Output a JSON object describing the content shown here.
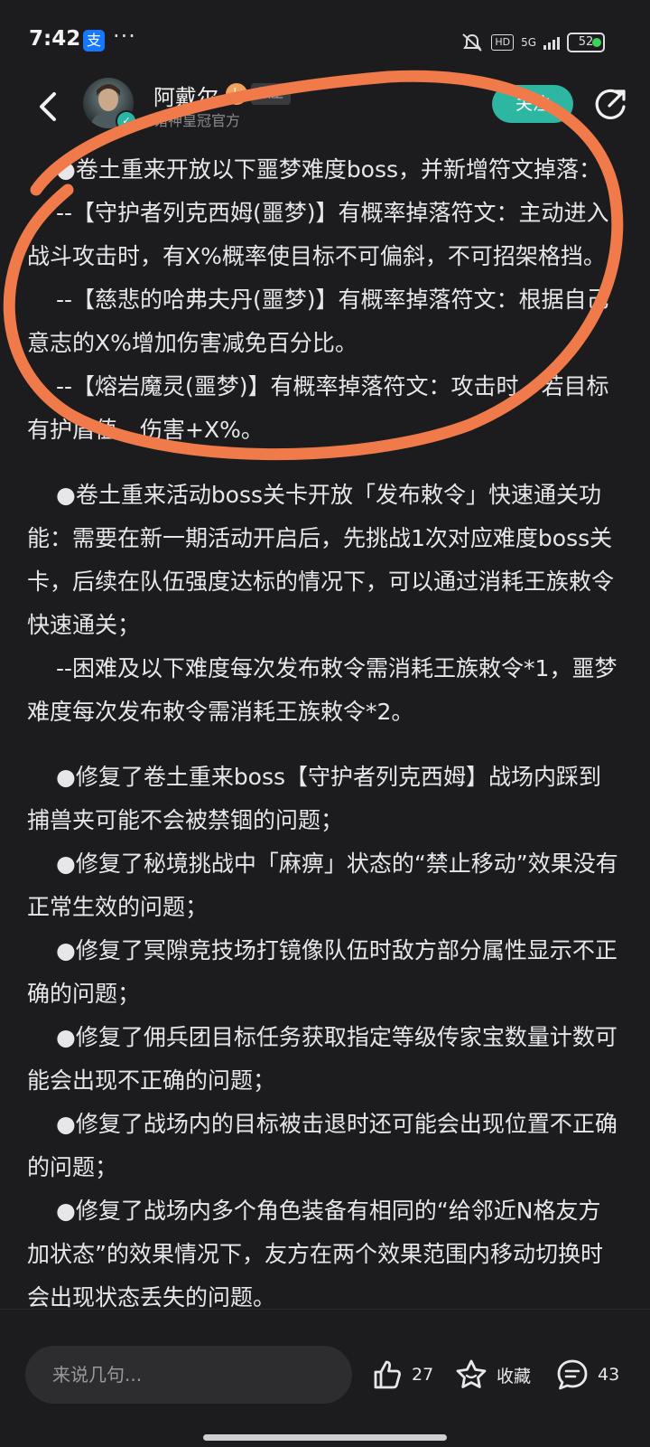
{
  "status_bar": {
    "time": "7:42",
    "app_badge": "支",
    "dots": "···",
    "hd": "HD",
    "network": "5G",
    "battery": "52"
  },
  "header": {
    "author_name": "阿戴尔",
    "level_badge": "L",
    "role_badge": "版主",
    "author_subtitle": "诸神皇冠官方",
    "follow_label": "关注"
  },
  "article": {
    "paragraphs": [
      "●卷土重来开放以下噩梦难度boss，并新增符文掉落：",
      "--【守护者列克西姆(噩梦)】有概率掉落符文：主动进入战斗攻击时，有X%概率使目标不可偏斜，不可招架格挡。",
      "--【慈悲的哈弗夫丹(噩梦)】有概率掉落符文：根据自己意志的X%增加伤害减免百分比。",
      "--【熔岩魔灵(噩梦)】有概率掉落符文：攻击时，若目标有护盾值，伤害+X%。",
      "●卷土重来活动boss关卡开放「发布敕令」快速通关功能：需要在新一期活动开启后，先挑战1次对应难度boss关卡，后续在队伍强度达标的情况下，可以通过消耗王族敕令快速通关；",
      "--困难及以下难度每次发布敕令需消耗王族敕令*1，噩梦难度每次发布敕令需消耗王族敕令*2。",
      "●修复了卷土重来boss【守护者列克西姆】战场内踩到捕兽夹可能不会被禁锢的问题；",
      "●修复了秘境挑战中「麻痹」状态的“禁止移动”效果没有正常生效的问题；",
      "●修复了冥隙竞技场打镜像队伍时敌方部分属性显示不正确的问题；",
      "●修复了佣兵团目标任务获取指定等级传家宝数量计数可能会出现不正确的问题；",
      "●修复了战场内的目标被击退时还可能会出现位置不正确的问题；",
      "●修复了战场内多个角色装备有相同的“给邻近N格友方加状态”的效果情况下，友方在两个效果范围内移动切换时会出现状态丢失的问题。"
    ]
  },
  "bottom_bar": {
    "comment_placeholder": "来说几句...",
    "like_count": "27",
    "favorite_label": "收藏",
    "comment_count": "43"
  },
  "colors": {
    "background": "#1c1c1e",
    "accent": "#2db7a3",
    "highlight_ring": "#f07a4a"
  }
}
